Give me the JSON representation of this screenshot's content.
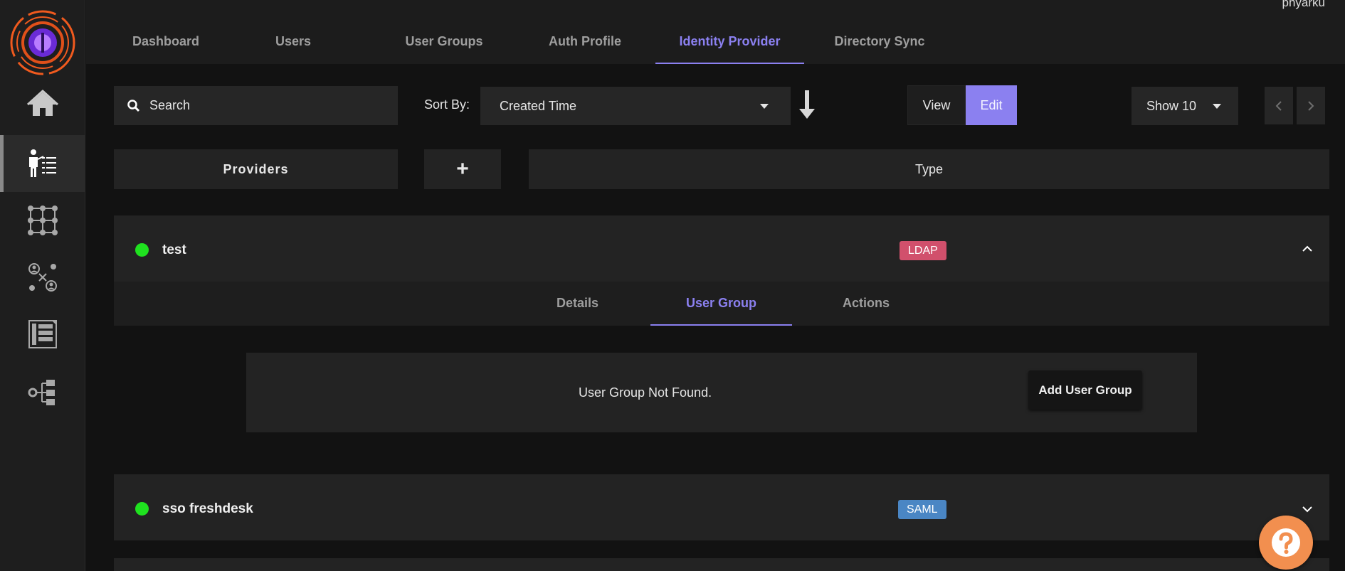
{
  "header": {
    "username": "phyarku",
    "tabs": [
      {
        "label": "Dashboard"
      },
      {
        "label": "Users"
      },
      {
        "label": "User Groups"
      },
      {
        "label": "Auth Profile"
      },
      {
        "label": "Identity Provider",
        "active": true
      },
      {
        "label": "Directory Sync"
      }
    ]
  },
  "sidebar": {
    "logo_icon": "logo-icon",
    "items": [
      {
        "icon": "home-icon"
      },
      {
        "icon": "identity-provider-icon",
        "active": true
      },
      {
        "icon": "network-grid-icon"
      },
      {
        "icon": "user-network-icon"
      },
      {
        "icon": "document-list-icon"
      },
      {
        "icon": "settings-tree-icon"
      }
    ]
  },
  "toolbar": {
    "search_placeholder": "Search",
    "sort_label": "Sort By:",
    "sort_value": "Created Time",
    "view_label": "View",
    "edit_label": "Edit",
    "show_value": "Show 10"
  },
  "table_header": {
    "providers": "Providers",
    "add": "+",
    "type": "Type"
  },
  "providers": [
    {
      "name": "test",
      "type": "LDAP",
      "status": "active",
      "expanded": true,
      "subtabs": [
        {
          "label": "Details"
        },
        {
          "label": "User Group",
          "active": true
        },
        {
          "label": "Actions"
        }
      ],
      "user_group": {
        "message": "User Group Not Found.",
        "add_label": "Add User Group"
      }
    },
    {
      "name": "sso freshdesk",
      "type": "SAML",
      "status": "active",
      "expanded": false
    }
  ],
  "colors": {
    "accent": "#8b80f0",
    "ldap_badge": "#d1506c",
    "saml_badge": "#4a86c4",
    "status_active": "#1fe21f",
    "help_button": "#f28f4f"
  }
}
